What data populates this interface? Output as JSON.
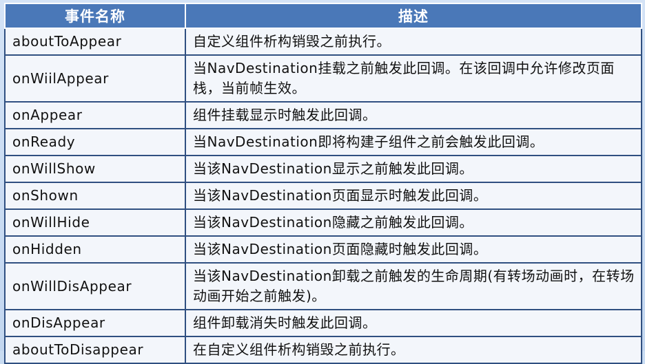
{
  "table": {
    "headers": {
      "event": "事件名称",
      "description": "描述"
    },
    "rows": [
      {
        "event": "aboutToAppear",
        "description": "自定义组件析构销毁之前执行。"
      },
      {
        "event": "onWiilAppear",
        "description": "当NavDestination挂载之前触发此回调。在该回调中允许修改页面栈，当前帧生效。"
      },
      {
        "event": "onAppear",
        "description": "组件挂载显示时触发此回调。"
      },
      {
        "event": "onReady",
        "description": "当NavDestination即将构建子组件之前会触发此回调。"
      },
      {
        "event": "onWillShow",
        "description": "当该NavDestination显示之前触发此回调。"
      },
      {
        "event": "onShown",
        "description": "当该NavDestination页面显示时触发此回调。"
      },
      {
        "event": "onWillHide",
        "description": "当该NavDestination隐藏之前触发此回调。"
      },
      {
        "event": "onHidden",
        "description": "当该NavDestination页面隐藏时触发此回调。"
      },
      {
        "event": "onWillDisAppear",
        "description": "当该NavDestination卸载之前触发的生命周期(有转场动画时，在转场动画开始之前触发)。"
      },
      {
        "event": "onDisAppear",
        "description": "组件卸载消失时触发此回调。"
      },
      {
        "event": "aboutToDisappear",
        "description": "在自定义组件析构销毁之前执行。"
      }
    ]
  },
  "colors": {
    "header_bg": "#4a78b8",
    "border": "#2f4f80",
    "cell_bg": "#f3f6fb",
    "page_bg": "#c9dcf2"
  }
}
